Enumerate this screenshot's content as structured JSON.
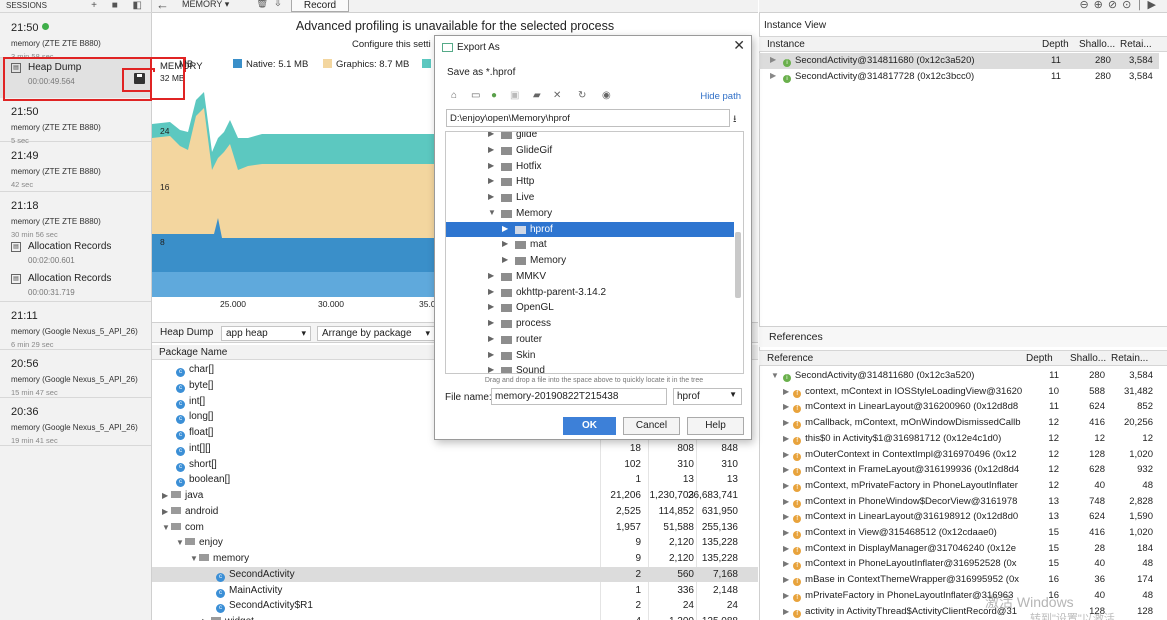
{
  "sessions": {
    "header": "SESSIONS",
    "items": [
      {
        "time": "21:50",
        "device": "memory (ZTE ZTE B880)",
        "dur": "3 min 58 sec"
      },
      {
        "time": "21:50",
        "device": "memory (ZTE ZTE B880)",
        "dur": "5 sec"
      },
      {
        "time": "21:49",
        "device": "memory (ZTE ZTE B880)",
        "dur": "42 sec"
      },
      {
        "time": "21:18",
        "device": "memory (ZTE ZTE B880)",
        "dur": "30 min 56 sec"
      },
      {
        "time": "21:11",
        "device": "memory (Google Nexus_5_API_26)",
        "dur": "6 min 29 sec"
      },
      {
        "time": "20:56",
        "device": "memory (Google Nexus_5_API_26)",
        "dur": "15 min 47 sec"
      },
      {
        "time": "20:36",
        "device": "memory (Google Nexus_5_API_26)",
        "dur": "19 min 41 sec"
      }
    ],
    "heap_dump": {
      "label": "Heap Dump",
      "time": "00:00:49.564"
    },
    "alloc1": {
      "label": "Allocation Records",
      "time": "00:02:00.601"
    },
    "alloc2": {
      "label": "Allocation Records",
      "time": "00:00:31.719"
    }
  },
  "toolbar": {
    "memory": "MEMORY",
    "record": "Record"
  },
  "profiler": {
    "advanced": "Advanced profiling is unavailable for the selected process",
    "configure": "Configure this setti",
    "memory_label": "MEMORY",
    "memory_short": "MB",
    "memory_value": "32 MB",
    "legend": [
      {
        "label": "Native: 5.1 MB",
        "color": "#3a8fc9"
      },
      {
        "label": "Graphics: 8.7 MB",
        "color": "#f3d69f"
      }
    ],
    "yticks": [
      "24",
      "16",
      "8"
    ],
    "xticks": [
      "25.000",
      "30.000",
      "35.0"
    ]
  },
  "heap": {
    "dump_label": "Heap Dump",
    "app_heap": "app heap",
    "arrange": "Arrange by package",
    "col_package": "Package Name",
    "rows": [
      {
        "name": "char[]",
        "kind": "class",
        "c1": "",
        "c2": "",
        "c3": ""
      },
      {
        "name": "byte[]",
        "kind": "class",
        "c1": "",
        "c2": "",
        "c3": ""
      },
      {
        "name": "int[]",
        "kind": "class",
        "c1": "",
        "c2": "",
        "c3": ""
      },
      {
        "name": "long[]",
        "kind": "class",
        "c1": "",
        "c2": "",
        "c3": ""
      },
      {
        "name": "float[]",
        "kind": "class",
        "c1": "",
        "c2": "",
        "c3": ""
      },
      {
        "name": "int[][]",
        "kind": "class",
        "c1": "18",
        "c2": "808",
        "c3": "848"
      },
      {
        "name": "short[]",
        "kind": "class",
        "c1": "102",
        "c2": "310",
        "c3": "310"
      },
      {
        "name": "boolean[]",
        "kind": "class",
        "c1": "1",
        "c2": "13",
        "c3": "13"
      },
      {
        "name": "java",
        "kind": "folder",
        "c1": "21,206",
        "c2": "1,230,703",
        "c3": "26,683,741"
      },
      {
        "name": "android",
        "kind": "folder",
        "c1": "2,525",
        "c2": "114,852",
        "c3": "631,950"
      },
      {
        "name": "com",
        "kind": "folder",
        "c1": "1,957",
        "c2": "51,588",
        "c3": "255,136"
      },
      {
        "name": "enjoy",
        "kind": "folder",
        "c1": "9",
        "c2": "2,120",
        "c3": "135,228"
      },
      {
        "name": "memory",
        "kind": "folder",
        "c1": "9",
        "c2": "2,120",
        "c3": "135,228"
      },
      {
        "name": "SecondActivity",
        "kind": "class",
        "c1": "2",
        "c2": "560",
        "c3": "7,168"
      },
      {
        "name": "MainActivity",
        "kind": "class",
        "c1": "1",
        "c2": "336",
        "c3": "2,148"
      },
      {
        "name": "SecondActivity$R1",
        "kind": "class",
        "c1": "2",
        "c2": "24",
        "c3": "24"
      },
      {
        "name": "widget",
        "kind": "folder",
        "c1": "4",
        "c2": "1,200",
        "c3": "125,088"
      }
    ]
  },
  "instance_view": {
    "title": "Instance View",
    "cols": [
      "Instance",
      "Depth",
      "Shallo...",
      "Retai..."
    ],
    "rows": [
      {
        "name": "SecondActivity@314811680 (0x12c3a520)",
        "depth": "11",
        "shallow": "280",
        "retained": "3,584"
      },
      {
        "name": "SecondActivity@314817728 (0x12c3bcc0)",
        "depth": "11",
        "shallow": "280",
        "retained": "3,584"
      }
    ]
  },
  "references": {
    "tab": "References",
    "cols": [
      "Reference",
      "Depth",
      "Shallo...",
      "Retain..."
    ],
    "rows": [
      {
        "name": "SecondActivity@314811680 (0x12c3a520)",
        "d": "11",
        "s": "280",
        "r": "3,584",
        "icon": "i"
      },
      {
        "name": "context, mContext in IOSStyleLoadingView@31620",
        "d": "10",
        "s": "588",
        "r": "31,482",
        "icon": "f"
      },
      {
        "name": "mContext in LinearLayout@316200960 (0x12d8d8",
        "d": "11",
        "s": "624",
        "r": "852",
        "icon": "f"
      },
      {
        "name": "mCallback, mContext, mOnWindowDismissedCallb",
        "d": "12",
        "s": "416",
        "r": "20,256",
        "icon": "f"
      },
      {
        "name": "this$0 in Activity$1@316981712 (0x12e4c1d0)",
        "d": "12",
        "s": "12",
        "r": "12",
        "icon": "f"
      },
      {
        "name": "mOuterContext in ContextImpl@316970496 (0x12",
        "d": "12",
        "s": "128",
        "r": "1,020",
        "icon": "f"
      },
      {
        "name": "mContext in FrameLayout@316199936 (0x12d8d4",
        "d": "12",
        "s": "628",
        "r": "932",
        "icon": "f"
      },
      {
        "name": "mContext, mPrivateFactory in PhoneLayoutInflater",
        "d": "12",
        "s": "40",
        "r": "48",
        "icon": "f"
      },
      {
        "name": "mContext in PhoneWindow$DecorView@3161978",
        "d": "13",
        "s": "748",
        "r": "2,828",
        "icon": "f"
      },
      {
        "name": "mContext in LinearLayout@316198912 (0x12d8d0",
        "d": "13",
        "s": "624",
        "r": "1,590",
        "icon": "f"
      },
      {
        "name": "mContext in View@315468512 (0x12cdaae0)",
        "d": "15",
        "s": "416",
        "r": "1,020",
        "icon": "f"
      },
      {
        "name": "mContext in DisplayManager@317046240 (0x12e",
        "d": "15",
        "s": "28",
        "r": "184",
        "icon": "f"
      },
      {
        "name": "mContext in PhoneLayoutInflater@316952528 (0x",
        "d": "15",
        "s": "40",
        "r": "48",
        "icon": "f"
      },
      {
        "name": "mBase in ContextThemeWrapper@316995952 (0x",
        "d": "16",
        "s": "36",
        "r": "174",
        "icon": "f"
      },
      {
        "name": "mPrivateFactory in PhoneLayoutInflater@316963",
        "d": "16",
        "s": "40",
        "r": "48",
        "icon": "f"
      },
      {
        "name": "activity in ActivityThread$ActivityClientRecord@31",
        "d": "",
        "s": "128",
        "r": "128",
        "icon": "f"
      }
    ]
  },
  "watermark": {
    "line1": "激活 Windows",
    "line2": "转到\"设置\"以激活 Windows。"
  },
  "dialog": {
    "title": "Export As",
    "save_as": "Save as *.hprof",
    "hide_path": "Hide path",
    "path": "D:\\enjoy\\open\\Memory\\hprof",
    "tree": [
      {
        "name": "glide",
        "level": 0,
        "open": false
      },
      {
        "name": "GlideGif",
        "level": 0,
        "open": false
      },
      {
        "name": "Hotfix",
        "level": 0,
        "open": false
      },
      {
        "name": "Http",
        "level": 0,
        "open": false
      },
      {
        "name": "Live",
        "level": 0,
        "open": false
      },
      {
        "name": "Memory",
        "level": 0,
        "open": true
      },
      {
        "name": "hprof",
        "level": 1,
        "open": false,
        "selected": true
      },
      {
        "name": "mat",
        "level": 1,
        "open": false
      },
      {
        "name": "Memory",
        "level": 1,
        "open": false
      },
      {
        "name": "MMKV",
        "level": 0,
        "open": false
      },
      {
        "name": "okhttp-parent-3.14.2",
        "level": 0,
        "open": false
      },
      {
        "name": "OpenGL",
        "level": 0,
        "open": false
      },
      {
        "name": "process",
        "level": 0,
        "open": false
      },
      {
        "name": "router",
        "level": 0,
        "open": false
      },
      {
        "name": "Skin",
        "level": 0,
        "open": false
      },
      {
        "name": "Sound",
        "level": 0,
        "open": false
      }
    ],
    "dnd_hint": "Drag and drop a file into the space above to quickly locate it in the tree",
    "file_name_label": "File name:",
    "file_name": "memory-20190822T215438",
    "file_type": "hprof",
    "ok": "OK",
    "cancel": "Cancel",
    "help": "Help"
  }
}
